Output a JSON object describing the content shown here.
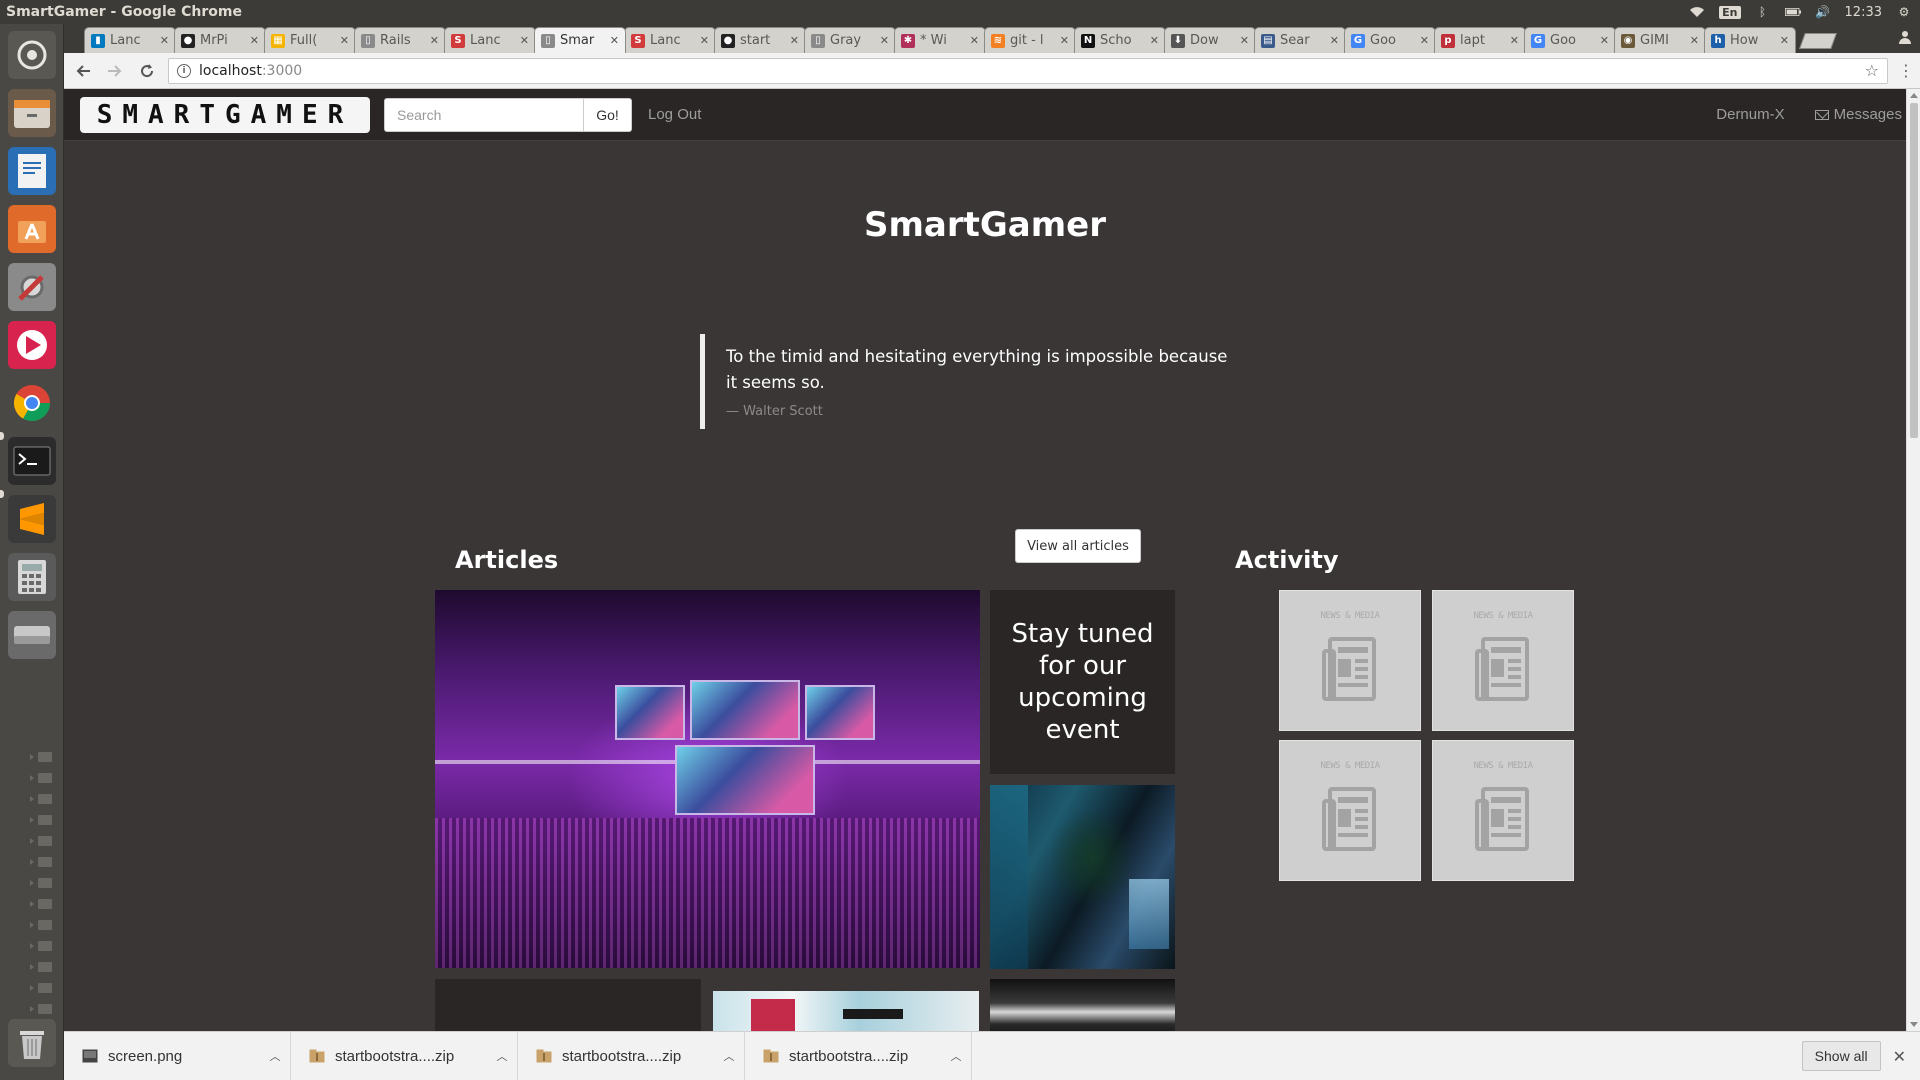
{
  "os": {
    "window_title": "SmartGamer - Google Chrome",
    "lang": "En",
    "clock": "12:33"
  },
  "browser": {
    "tabs": [
      {
        "label": "Lanc",
        "favicon": "trello-icon",
        "color": "#0079bf",
        "glyph": "▮"
      },
      {
        "label": "MrPi",
        "favicon": "github-icon",
        "color": "#222222",
        "glyph": "●"
      },
      {
        "label": "Full(",
        "favicon": "sheets-icon",
        "color": "#f4b400",
        "glyph": "▦"
      },
      {
        "label": "Rails",
        "favicon": "page-icon",
        "color": "#8a8a8a",
        "glyph": "▯"
      },
      {
        "label": "Lanc",
        "favicon": "s-icon",
        "color": "#d23b3b",
        "glyph": "S"
      },
      {
        "label": "Smar",
        "favicon": "page-icon",
        "color": "#8a8a8a",
        "glyph": "▯",
        "active": true
      },
      {
        "label": "Lanc",
        "favicon": "s-icon",
        "color": "#d23b3b",
        "glyph": "S"
      },
      {
        "label": "start",
        "favicon": "github-icon",
        "color": "#222222",
        "glyph": "●"
      },
      {
        "label": "Gray",
        "favicon": "page-icon",
        "color": "#8a8a8a",
        "glyph": "▯"
      },
      {
        "label": "* Wi",
        "favicon": "puzzle-icon",
        "color": "#b0305a",
        "glyph": "✱"
      },
      {
        "label": "git - l",
        "favicon": "so-icon",
        "color": "#f48024",
        "glyph": "≋"
      },
      {
        "label": "Scho",
        "favicon": "n-icon",
        "color": "#111111",
        "glyph": "N"
      },
      {
        "label": "Dow",
        "favicon": "download-icon",
        "color": "#555555",
        "glyph": "⬇"
      },
      {
        "label": "Sear",
        "favicon": "doc-icon",
        "color": "#3a5a8a",
        "glyph": "▤"
      },
      {
        "label": "Goo",
        "favicon": "google-icon",
        "color": "#4285f4",
        "glyph": "G"
      },
      {
        "label": "lapt",
        "favicon": "png-icon",
        "color": "#c0303a",
        "glyph": "p"
      },
      {
        "label": "Goo",
        "favicon": "google-icon",
        "color": "#4285f4",
        "glyph": "G"
      },
      {
        "label": "GIMI",
        "favicon": "gimp-icon",
        "color": "#6a5a3a",
        "glyph": "◉"
      },
      {
        "label": "How",
        "favicon": "h-icon",
        "color": "#1d5fa8",
        "glyph": "h"
      }
    ],
    "url_host": "localhost",
    "url_port": ":3000"
  },
  "site": {
    "brand": "SMARTGAMER",
    "search_placeholder": "Search",
    "search_button": "Go!",
    "logout": "Log Out",
    "username": "Dernum-X",
    "messages": "Messages"
  },
  "hero": {
    "title": "SmartGamer",
    "quote": "To the timid and hesitating everything is impossible because it seems so.",
    "author": "— Walter Scott"
  },
  "articles": {
    "heading": "Articles",
    "view_all": "View all articles",
    "event_text": "Stay tuned for our upcoming event"
  },
  "activity": {
    "heading": "Activity",
    "cards": [
      {
        "label": "NEWS & MEDIA"
      },
      {
        "label": "NEWS & MEDIA"
      },
      {
        "label": "NEWS & MEDIA"
      },
      {
        "label": "NEWS & MEDIA"
      }
    ]
  },
  "downloads": {
    "items": [
      {
        "name": "screen.png",
        "icon": "image-file-icon"
      },
      {
        "name": "startbootstra....zip",
        "icon": "zip-file-icon"
      },
      {
        "name": "startbootstra....zip",
        "icon": "zip-file-icon"
      },
      {
        "name": "startbootstra....zip",
        "icon": "zip-file-icon"
      }
    ],
    "show_all": "Show all"
  },
  "colors": {
    "page_bg": "#3a3636",
    "navbar_bg": "#2a2625",
    "card_bg": "#cfcfcf"
  }
}
